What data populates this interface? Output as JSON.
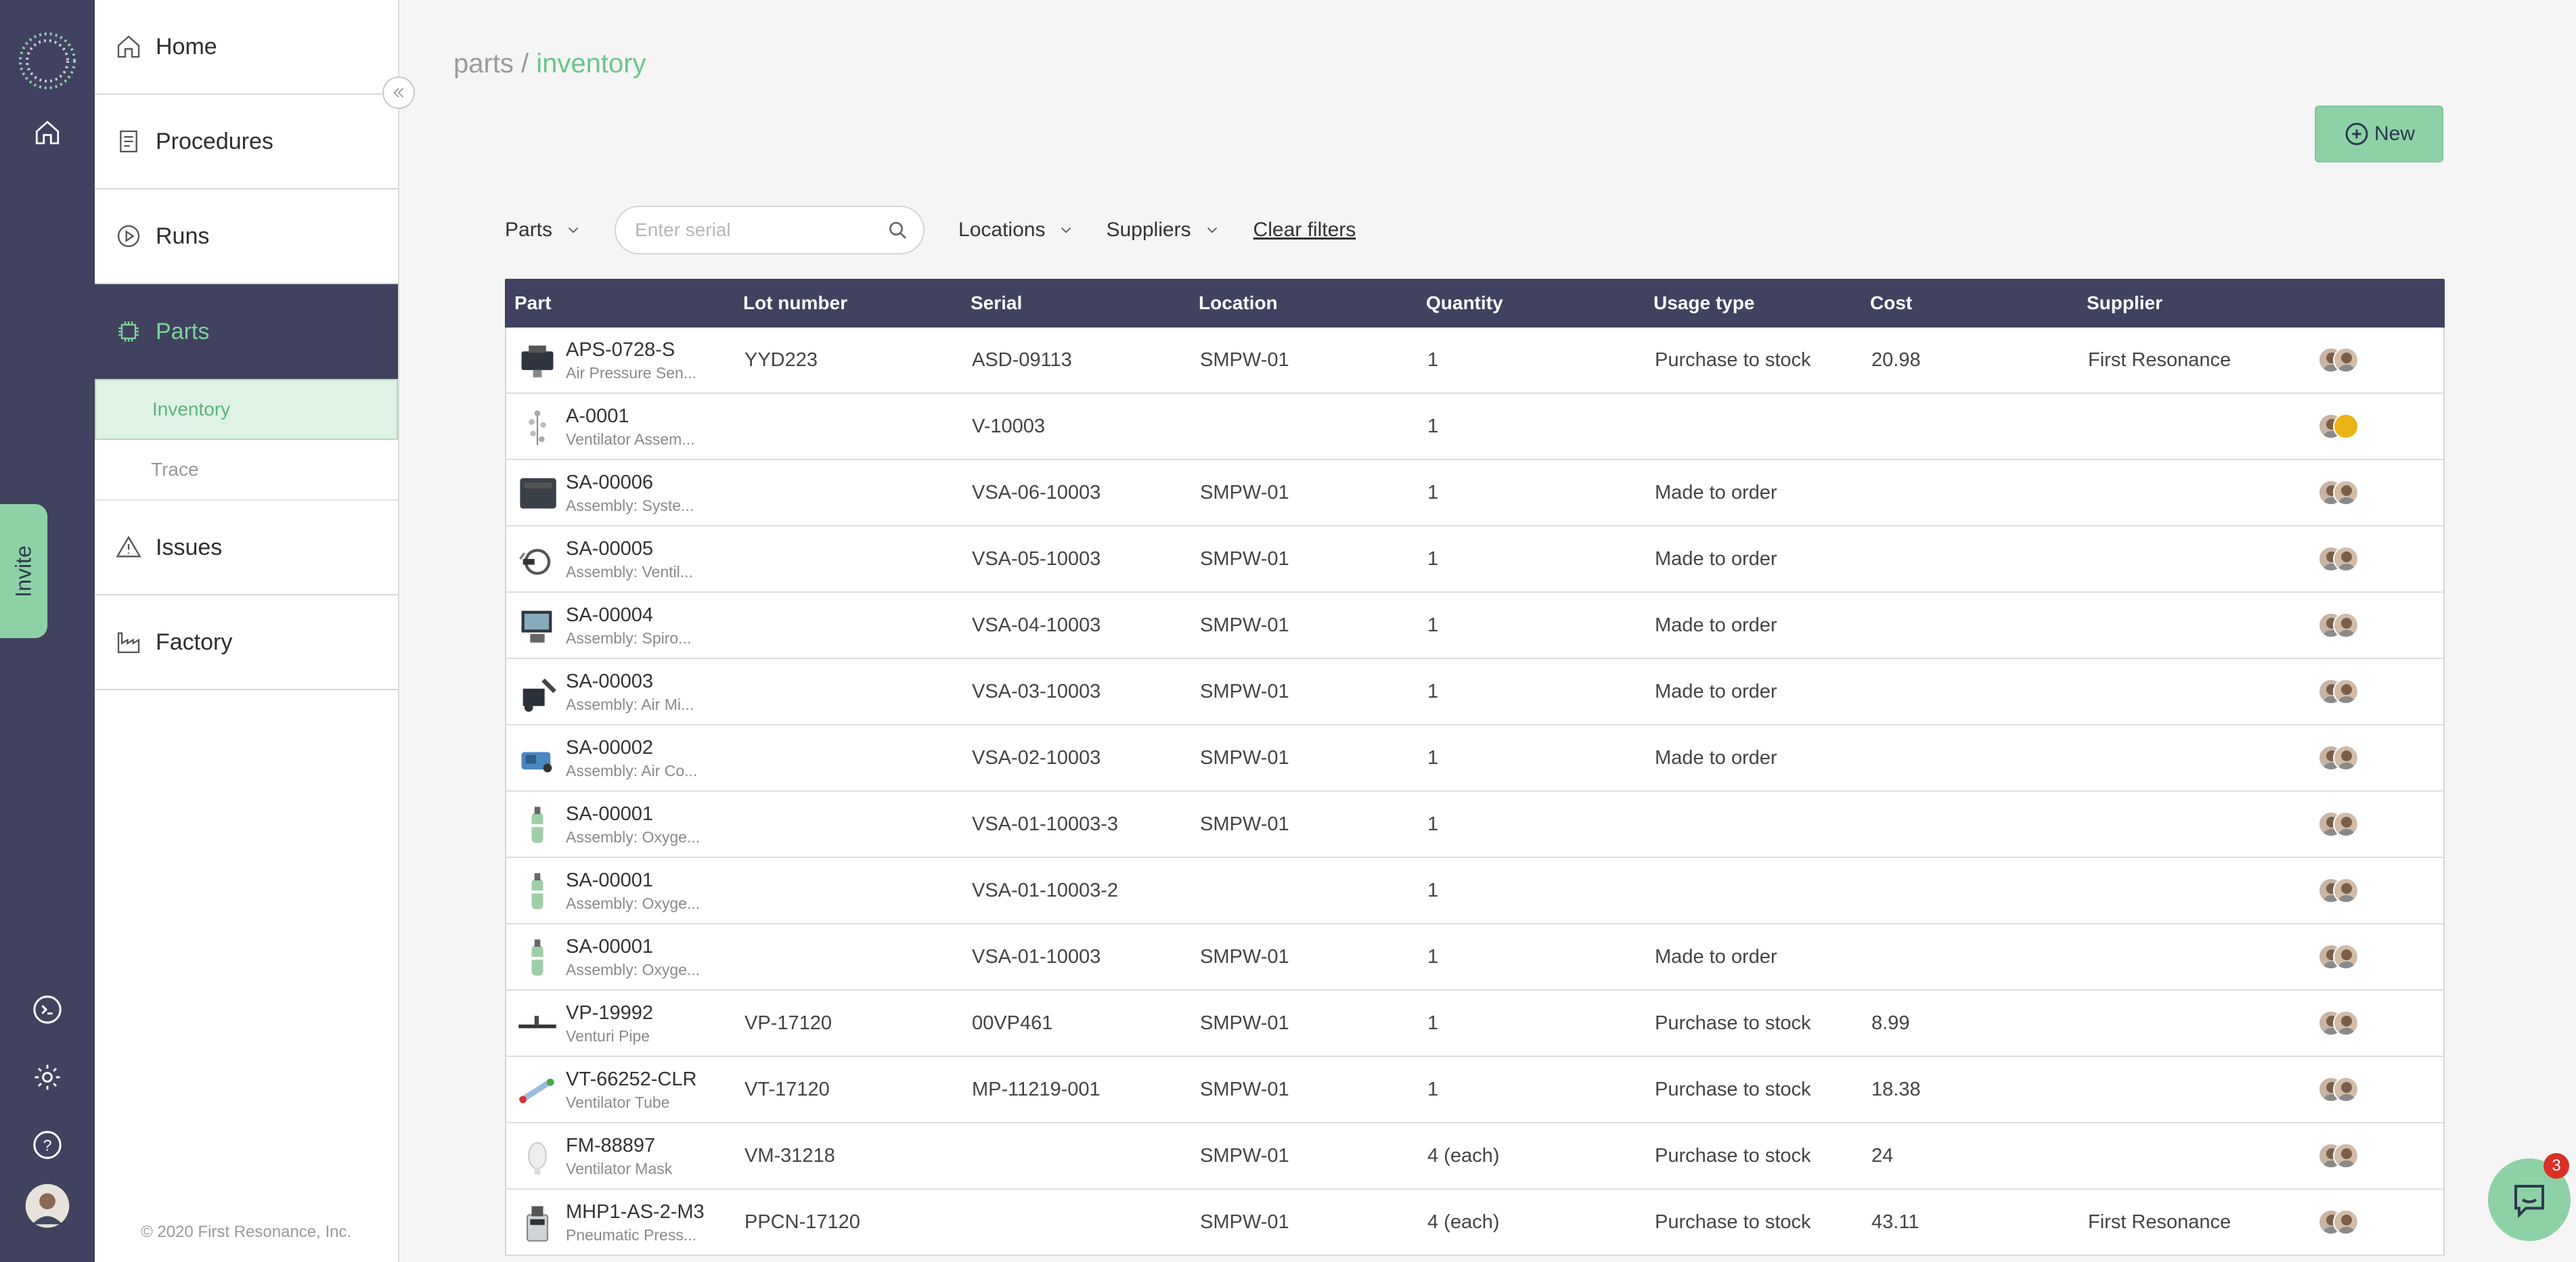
{
  "rail": {
    "invite_label": "Invite"
  },
  "nav": {
    "items": [
      {
        "label": "Home",
        "icon": "home-icon"
      },
      {
        "label": "Procedures",
        "icon": "document-icon"
      },
      {
        "label": "Runs",
        "icon": "play-icon"
      },
      {
        "label": "Parts",
        "icon": "chip-icon"
      }
    ],
    "sub_items": [
      {
        "label": "Inventory"
      },
      {
        "label": "Trace"
      }
    ],
    "items_lower": [
      {
        "label": "Issues",
        "icon": "warning-icon"
      },
      {
        "label": "Factory",
        "icon": "factory-icon"
      }
    ],
    "copyright": "© 2020 First Resonance, Inc."
  },
  "header": {
    "breadcrumb_parent": "parts",
    "breadcrumb_sep": " / ",
    "breadcrumb_current": "inventory",
    "new_label": "New"
  },
  "filters": {
    "parts_label": "Parts",
    "search_placeholder": "Enter serial",
    "locations_label": "Locations",
    "suppliers_label": "Suppliers",
    "clear_label": "Clear filters"
  },
  "table": {
    "columns": [
      "Part",
      "Lot number",
      "Serial",
      "Location",
      "Quantity",
      "Usage type",
      "Cost",
      "Supplier"
    ],
    "rows": [
      {
        "part": "APS-0728-S",
        "desc": "Air Pressure Sen...",
        "lot": "YYD223",
        "serial": "ASD-09113",
        "location": "SMPW-01",
        "qty": "1",
        "usage": "Purchase to stock",
        "cost": "20.98",
        "supplier": "First Resonance",
        "thumb": "sensor"
      },
      {
        "part": "A-0001",
        "desc": "Ventilator Assem...",
        "lot": "",
        "serial": "V-10003",
        "location": "",
        "qty": "1",
        "usage": "",
        "cost": "",
        "supplier": "",
        "thumb": "tree"
      },
      {
        "part": "SA-00006",
        "desc": "Assembly: Syste...",
        "lot": "",
        "serial": "VSA-06-10003",
        "location": "SMPW-01",
        "qty": "1",
        "usage": "Made to order",
        "cost": "",
        "supplier": "",
        "thumb": "box"
      },
      {
        "part": "SA-00005",
        "desc": "Assembly: Ventil...",
        "lot": "",
        "serial": "VSA-05-10003",
        "location": "SMPW-01",
        "qty": "1",
        "usage": "Made to order",
        "cost": "",
        "supplier": "",
        "thumb": "hose"
      },
      {
        "part": "SA-00004",
        "desc": "Assembly: Spiro...",
        "lot": "",
        "serial": "VSA-04-10003",
        "location": "SMPW-01",
        "qty": "1",
        "usage": "Made to order",
        "cost": "",
        "supplier": "",
        "thumb": "monitor"
      },
      {
        "part": "SA-00003",
        "desc": "Assembly: Air Mi...",
        "lot": "",
        "serial": "VSA-03-10003",
        "location": "SMPW-01",
        "qty": "1",
        "usage": "Made to order",
        "cost": "",
        "supplier": "",
        "thumb": "mixer"
      },
      {
        "part": "SA-00002",
        "desc": "Assembly: Air Co...",
        "lot": "",
        "serial": "VSA-02-10003",
        "location": "SMPW-01",
        "qty": "1",
        "usage": "Made to order",
        "cost": "",
        "supplier": "",
        "thumb": "compressor"
      },
      {
        "part": "SA-00001",
        "desc": "Assembly: Oxyge...",
        "lot": "",
        "serial": "VSA-01-10003-3",
        "location": "SMPW-01",
        "qty": "1",
        "usage": "",
        "cost": "",
        "supplier": "",
        "thumb": "cylinder"
      },
      {
        "part": "SA-00001",
        "desc": "Assembly: Oxyge...",
        "lot": "",
        "serial": "VSA-01-10003-2",
        "location": "",
        "qty": "1",
        "usage": "",
        "cost": "",
        "supplier": "",
        "thumb": "cylinder"
      },
      {
        "part": "SA-00001",
        "desc": "Assembly: Oxyge...",
        "lot": "",
        "serial": "VSA-01-10003",
        "location": "SMPW-01",
        "qty": "1",
        "usage": "Made to order",
        "cost": "",
        "supplier": "",
        "thumb": "cylinder"
      },
      {
        "part": "VP-19992",
        "desc": "Venturi Pipe",
        "lot": "VP-17120",
        "serial": "00VP461",
        "location": "SMPW-01",
        "qty": "1",
        "usage": "Purchase to stock",
        "cost": "8.99",
        "supplier": "",
        "thumb": "pipe"
      },
      {
        "part": "VT-66252-CLR",
        "desc": "Ventilator Tube",
        "lot": "VT-17120",
        "serial": "MP-11219-001",
        "location": "SMPW-01",
        "qty": "1",
        "usage": "Purchase to stock",
        "cost": "18.38",
        "supplier": "",
        "thumb": "tube"
      },
      {
        "part": "FM-88897",
        "desc": "Ventilator Mask",
        "lot": "VM-31218",
        "serial": "",
        "location": "SMPW-01",
        "qty": "4 (each)",
        "usage": "Purchase to stock",
        "cost": "24",
        "supplier": "",
        "thumb": "mask"
      },
      {
        "part": "MHP1-AS-2-M3",
        "desc": "Pneumatic Press...",
        "lot": "PPCN-17120",
        "serial": "",
        "location": "SMPW-01",
        "qty": "4 (each)",
        "usage": "Purchase to stock",
        "cost": "43.11",
        "supplier": "First Resonance",
        "thumb": "gauge"
      }
    ]
  },
  "chat": {
    "badge_count": "3"
  },
  "colors": {
    "rail": "#40425f",
    "accent": "#6cc48c",
    "button": "#8fd1a7"
  }
}
